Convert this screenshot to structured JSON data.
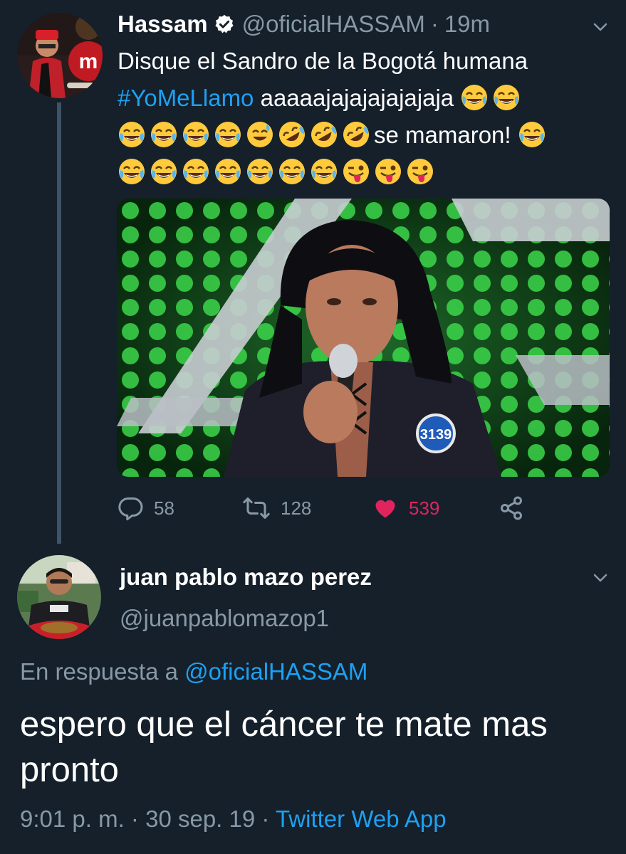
{
  "tweet": {
    "display_name": "Hassam",
    "handle": "@oficialHASSAM",
    "separator": "·",
    "time": "19m",
    "text_before_hashtag": "Disque el Sandro de la Bogotá humana",
    "hashtag": "#YoMeLlamo",
    "text_after_hashtag": "aaaaajajajajajajaja",
    "text_mid": "se mamaron!",
    "emoji_row_1": [
      "joy",
      "joy"
    ],
    "emoji_row_2": [
      "joy",
      "joy",
      "joy",
      "joy",
      "sweat-smile",
      "rofl",
      "rofl",
      "rofl"
    ],
    "emoji_row_2_end": [
      "joy"
    ],
    "emoji_row_3": [
      "joy",
      "joy",
      "joy",
      "joy",
      "joy",
      "joy",
      "joy",
      "tongue-wink",
      "tongue-wink",
      "tongue-wink"
    ],
    "media_badge": "3139",
    "counts": {
      "replies": "58",
      "retweets": "128",
      "likes": "539"
    }
  },
  "reply": {
    "display_name": "juan pablo mazo perez",
    "handle": "@juanpablomazop1",
    "reply_prefix": "En respuesta a",
    "reply_to_handle": "@oficialHASSAM",
    "text": "espero que el cáncer te mate mas pronto",
    "time": "9:01 p. m.",
    "separator": "·",
    "date": "30 sep. 19",
    "source": "Twitter Web App"
  },
  "colors": {
    "background": "#15202b",
    "secondary_text": "#8899a6",
    "accent_blue": "#1da1f2",
    "like_pink": "#e0245e",
    "thread_line": "#3d5466"
  },
  "icons": {
    "verified": "verified-badge-icon",
    "caret": "chevron-down-icon",
    "reply": "reply-icon",
    "retweet": "retweet-icon",
    "like": "heart-icon",
    "share": "share-icon"
  }
}
